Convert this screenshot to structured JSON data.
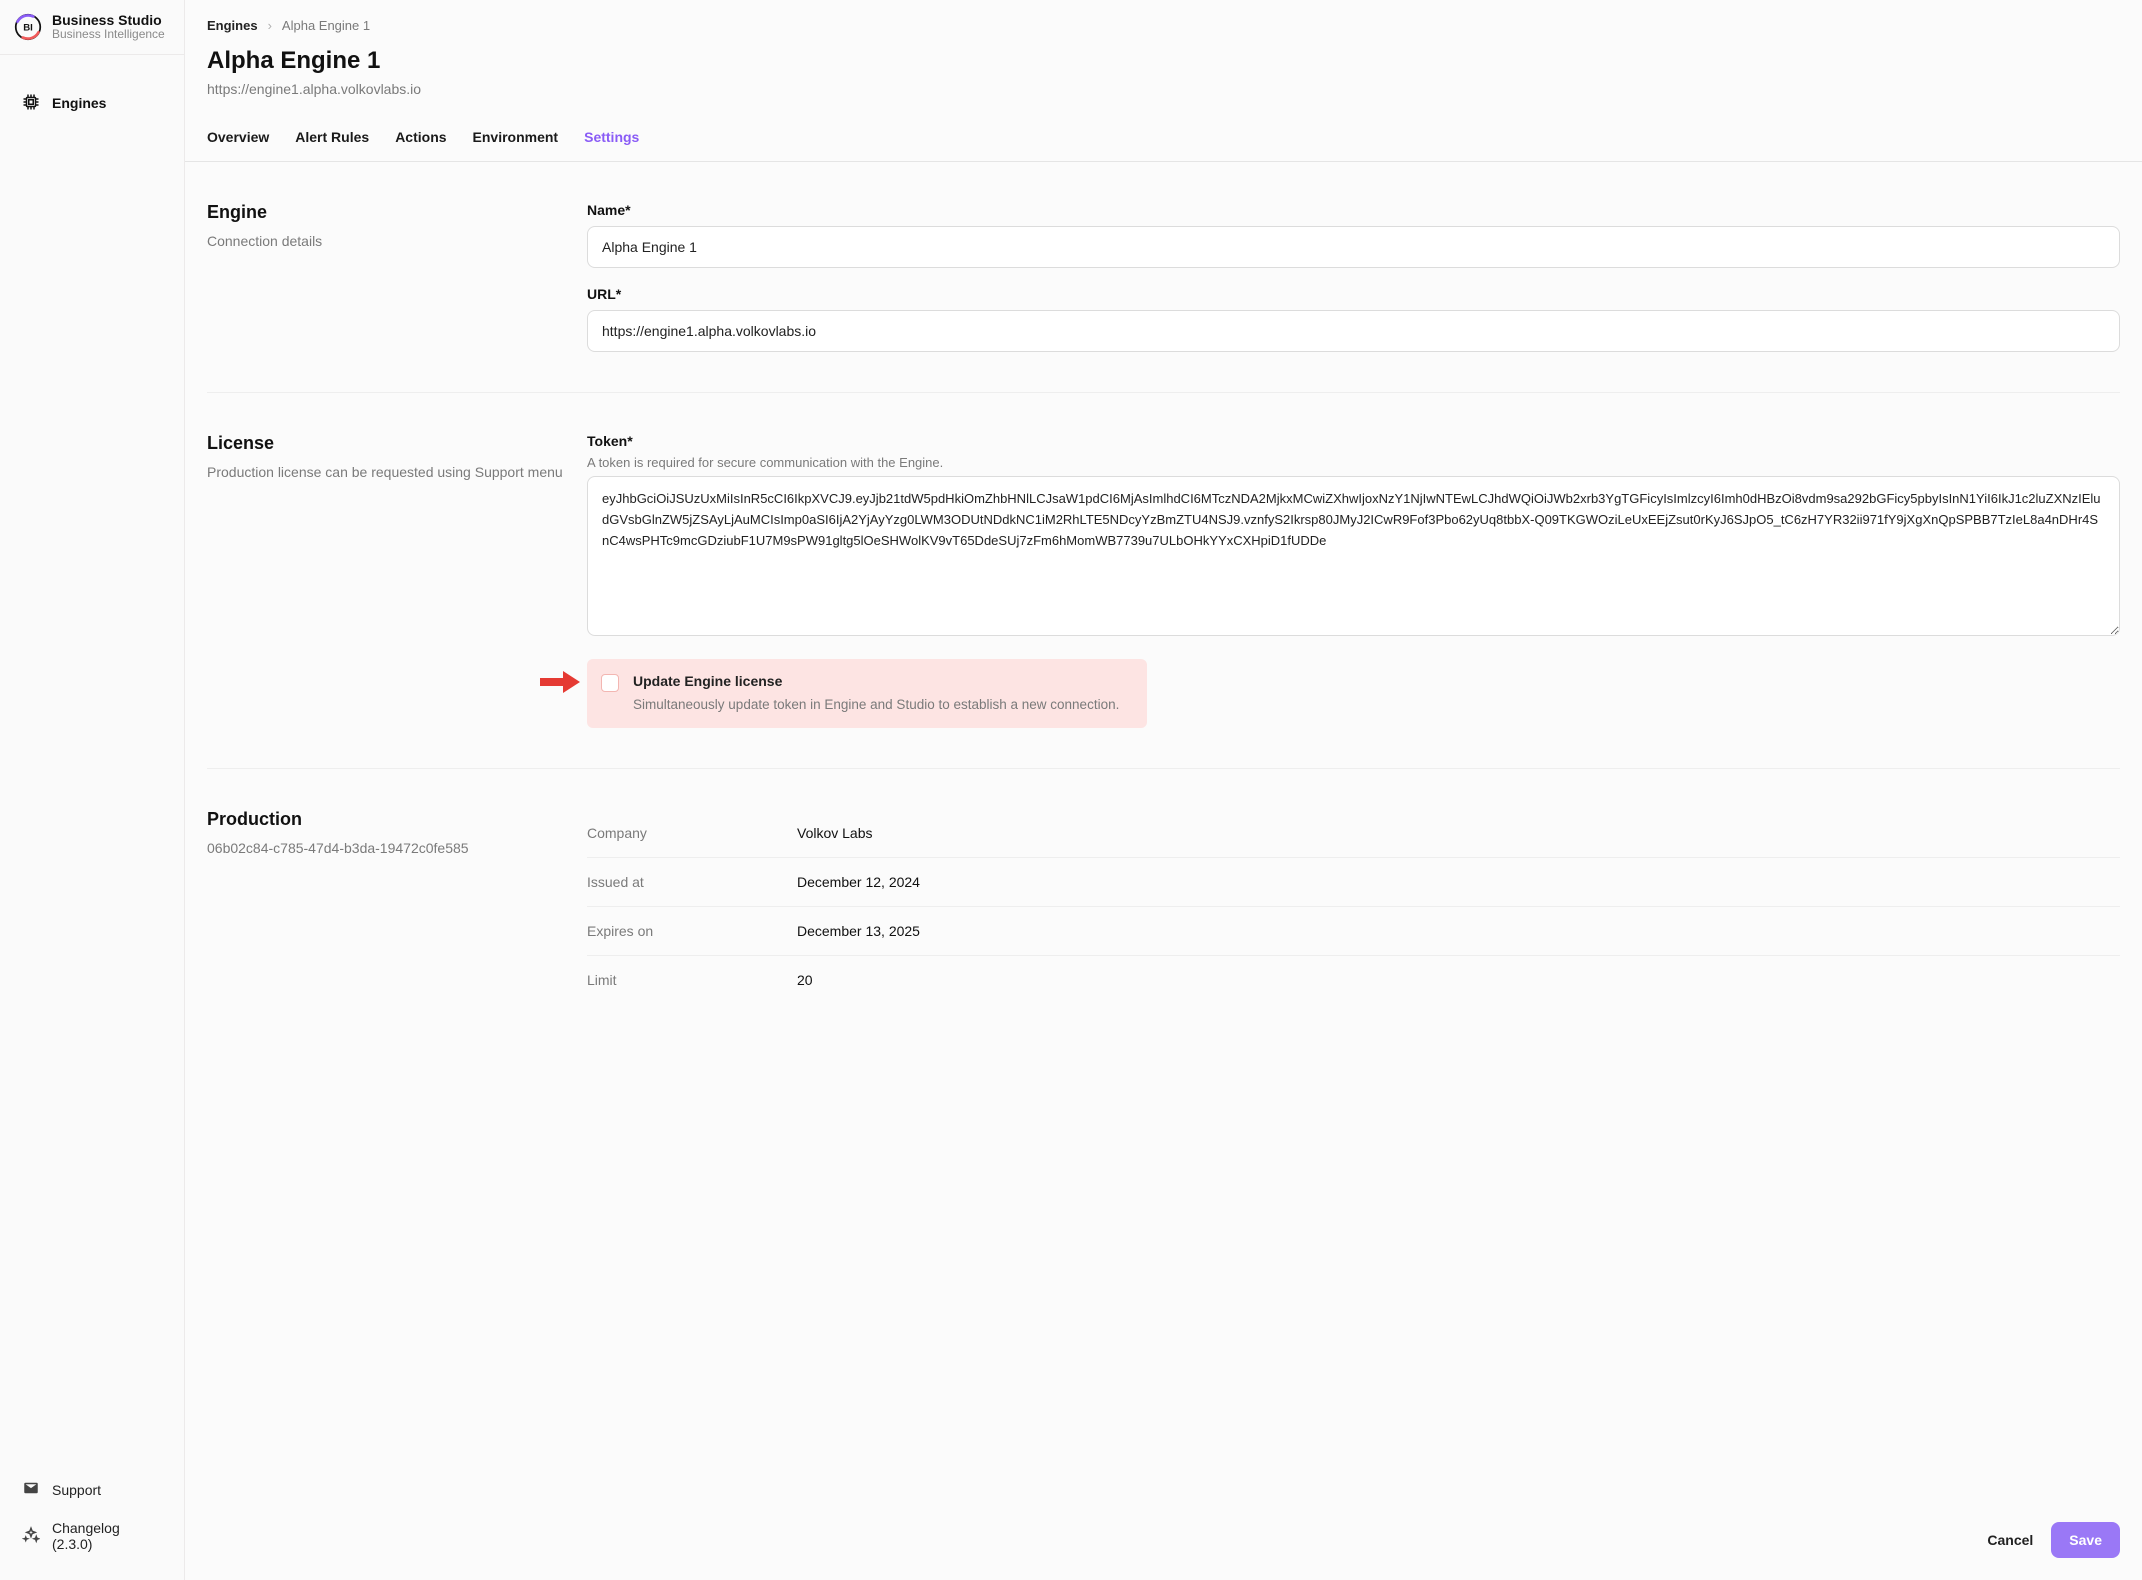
{
  "brand": {
    "title": "Business Studio",
    "subtitle": "Business Intelligence"
  },
  "sidebar": {
    "items": [
      {
        "label": "Engines"
      }
    ],
    "footer": {
      "support": "Support",
      "changelog": "Changelog (2.3.0)"
    }
  },
  "breadcrumb": {
    "root": "Engines",
    "current": "Alpha Engine 1"
  },
  "header": {
    "title": "Alpha Engine 1",
    "subtitle": "https://engine1.alpha.volkovlabs.io"
  },
  "tabs": [
    {
      "label": "Overview"
    },
    {
      "label": "Alert Rules"
    },
    {
      "label": "Actions"
    },
    {
      "label": "Environment"
    },
    {
      "label": "Settings",
      "active": true
    }
  ],
  "engine": {
    "section_title": "Engine",
    "section_desc": "Connection details",
    "name_label": "Name*",
    "name_value": "Alpha Engine 1",
    "url_label": "URL*",
    "url_value": "https://engine1.alpha.volkovlabs.io"
  },
  "license": {
    "section_title": "License",
    "section_desc": "Production license can be requested using Support menu",
    "token_label": "Token*",
    "token_help": "A token is required for secure communication with the Engine.",
    "token_value": "eyJhbGciOiJSUzUxMiIsInR5cCI6IkpXVCJ9.eyJjb21tdW5pdHkiOmZhbHNlLCJsaW1pdCI6MjAsImlhdCI6MTczNDA2MjkxMCwiZXhwIjoxNzY1NjIwNTEwLCJhdWQiOiJWb2xrb3YgTGFicyIsImlzcyI6Imh0dHBzOi8vdm9sa292bGFicy5pbyIsInN1YiI6IkJ1c2luZXNzIEludGVsbGlnZW5jZSAyLjAuMCIsImp0aSI6IjA2YjAyYzg0LWM3ODUtNDdkNC1iM2RhLTE5NDcyYzBmZTU4NSJ9.vznfyS2Ikrsp80JMyJ2ICwR9Fof3Pbo62yUq8tbbX-Q09TKGWOziLeUxEEjZsut0rKyJ6SJpO5_tC6zH7YR32ii971fY9jXgXnQpSPBB7TzIeL8a4nDHr4SnC4wsPHTc9mcGDziubF1U7M9sPW91gltg5lOeSHWolKV9vT65DdeSUj7zFm6hMomWB7739u7ULbOHkYYxCXHpiD1fUDDe",
    "update_title": "Update Engine license",
    "update_desc": "Simultaneously update token in Engine and Studio to establish a new connection."
  },
  "production": {
    "section_title": "Production",
    "section_desc": "06b02c84-c785-47d4-b3da-19472c0fe585",
    "rows": [
      {
        "key": "Company",
        "value": "Volkov Labs"
      },
      {
        "key": "Issued at",
        "value": "December 12, 2024"
      },
      {
        "key": "Expires on",
        "value": "December 13, 2025"
      },
      {
        "key": "Limit",
        "value": "20"
      }
    ]
  },
  "actions": {
    "cancel": "Cancel",
    "save": "Save"
  }
}
